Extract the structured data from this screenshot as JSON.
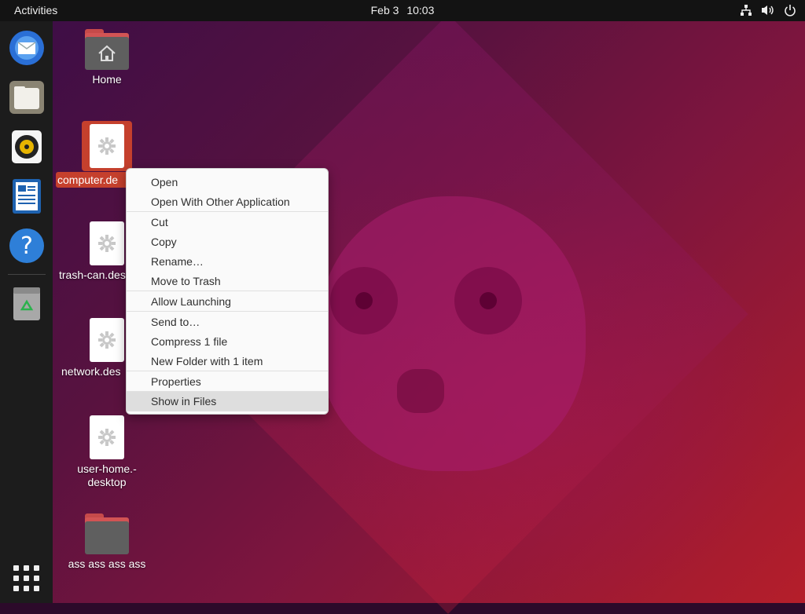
{
  "topbar": {
    "activities": "Activities",
    "date": "Feb 3",
    "time": "10:03",
    "tray_icons": [
      "network-icon",
      "volume-icon",
      "power-icon"
    ]
  },
  "dock": {
    "apps": [
      {
        "name": "thunderbird",
        "icon": "mail-icon"
      },
      {
        "name": "files",
        "icon": "files-icon"
      },
      {
        "name": "rhythmbox",
        "icon": "music-icon"
      },
      {
        "name": "libreoffice-writer",
        "icon": "writer-icon"
      },
      {
        "name": "help",
        "icon": "help-icon"
      },
      {
        "name": "trash",
        "icon": "trash-icon"
      }
    ],
    "show_apps_icon": "grid-icon"
  },
  "desktop": {
    "icons": [
      {
        "label": "Home",
        "type": "home-folder"
      },
      {
        "label": "computer.desktop",
        "label_visible": "computer.de",
        "type": "desktop-file",
        "selected": true
      },
      {
        "label": "trash-can.desktop",
        "label_visible": "trash-can.des",
        "type": "desktop-file"
      },
      {
        "label": "network.desktop",
        "label_visible": "network.des",
        "type": "desktop-file"
      },
      {
        "label_line1": "user-home.-",
        "label_line2": "desktop",
        "type": "desktop-file"
      },
      {
        "label": "ass ass ass ass",
        "type": "folder"
      }
    ]
  },
  "context_menu": {
    "items": [
      "Open",
      "Open With Other Application",
      "Cut",
      "Copy",
      "Rename…",
      "Move to Trash",
      "Allow Launching",
      "Send to…",
      "Compress 1 file",
      "New Folder with 1 item",
      "Properties",
      "Show in Files"
    ],
    "hovered_item": "Show in Files"
  },
  "colors": {
    "selection": "#c5402d",
    "topbar": "#131313",
    "dock": "#1c1c1c",
    "menu_bg": "#fafafa",
    "menu_hover": "#dedede"
  }
}
